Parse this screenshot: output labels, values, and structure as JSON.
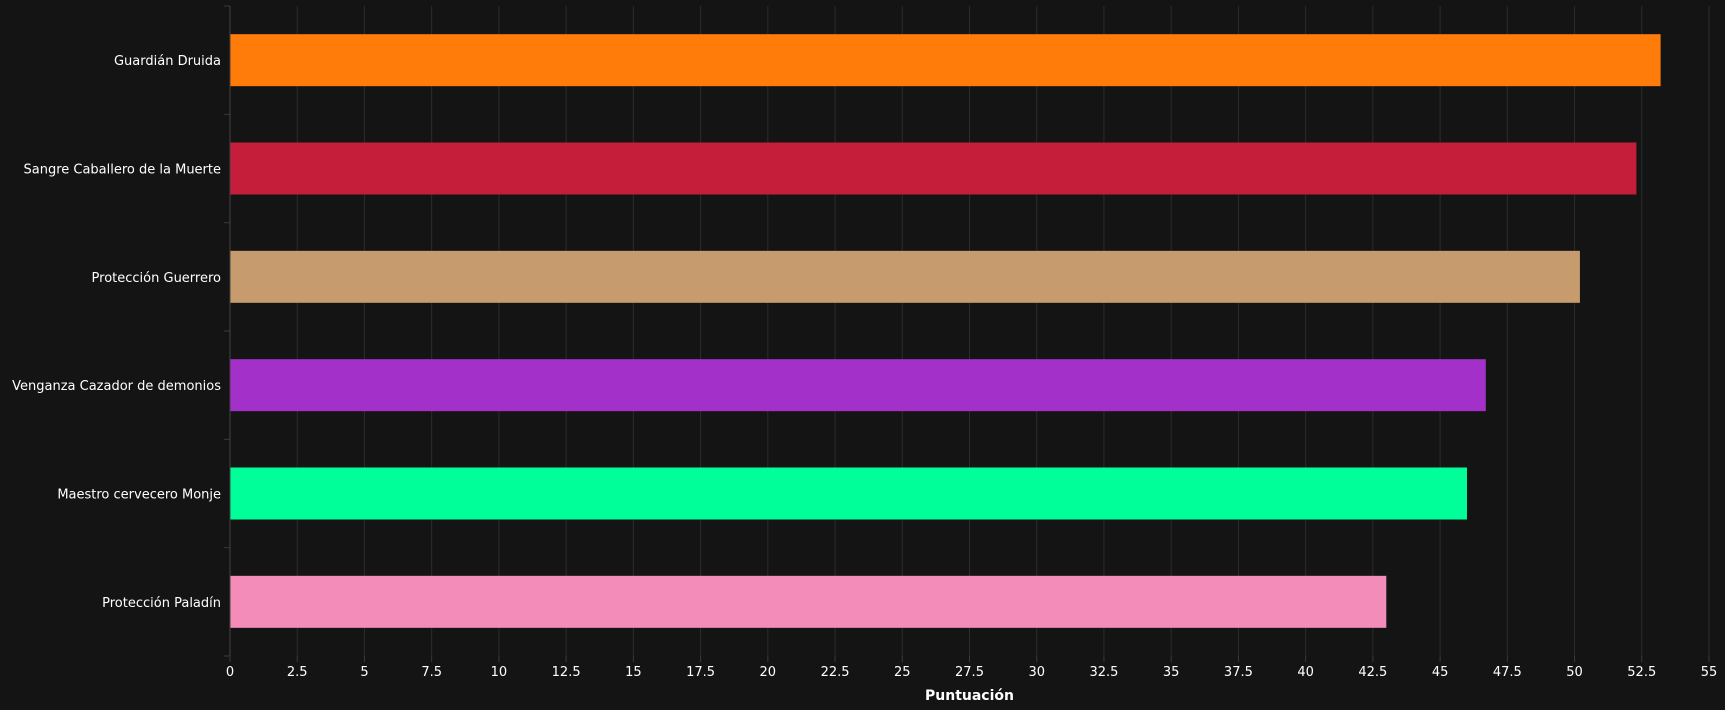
{
  "chart_data": {
    "type": "bar",
    "orientation": "horizontal",
    "categories": [
      "Guardián Druida",
      "Sangre Caballero de la Muerte",
      "Protección Guerrero",
      "Venganza Cazador de demonios",
      "Maestro cervecero Monje",
      "Protección Paladín"
    ],
    "values": [
      53.2,
      52.3,
      50.2,
      46.7,
      46.0,
      43.0
    ],
    "colors": [
      "#FF7C0A",
      "#C41E3A",
      "#C69B6D",
      "#A330C9",
      "#00FF98",
      "#F48CBA"
    ],
    "xlabel": "Puntuación",
    "ylabel": "",
    "xlim": [
      0,
      55
    ],
    "xticks": [
      "0",
      "2.5",
      "5",
      "7.5",
      "10",
      "12.5",
      "15",
      "17.5",
      "20",
      "22.5",
      "25",
      "27.5",
      "30",
      "32.5",
      "35",
      "37.5",
      "40",
      "42.5",
      "45",
      "47.5",
      "50",
      "52.5",
      "55"
    ],
    "grid": true,
    "legend": "none"
  },
  "theme": {
    "background": "#141414",
    "text": "#ffffff",
    "grid": "#2c2c2c"
  }
}
